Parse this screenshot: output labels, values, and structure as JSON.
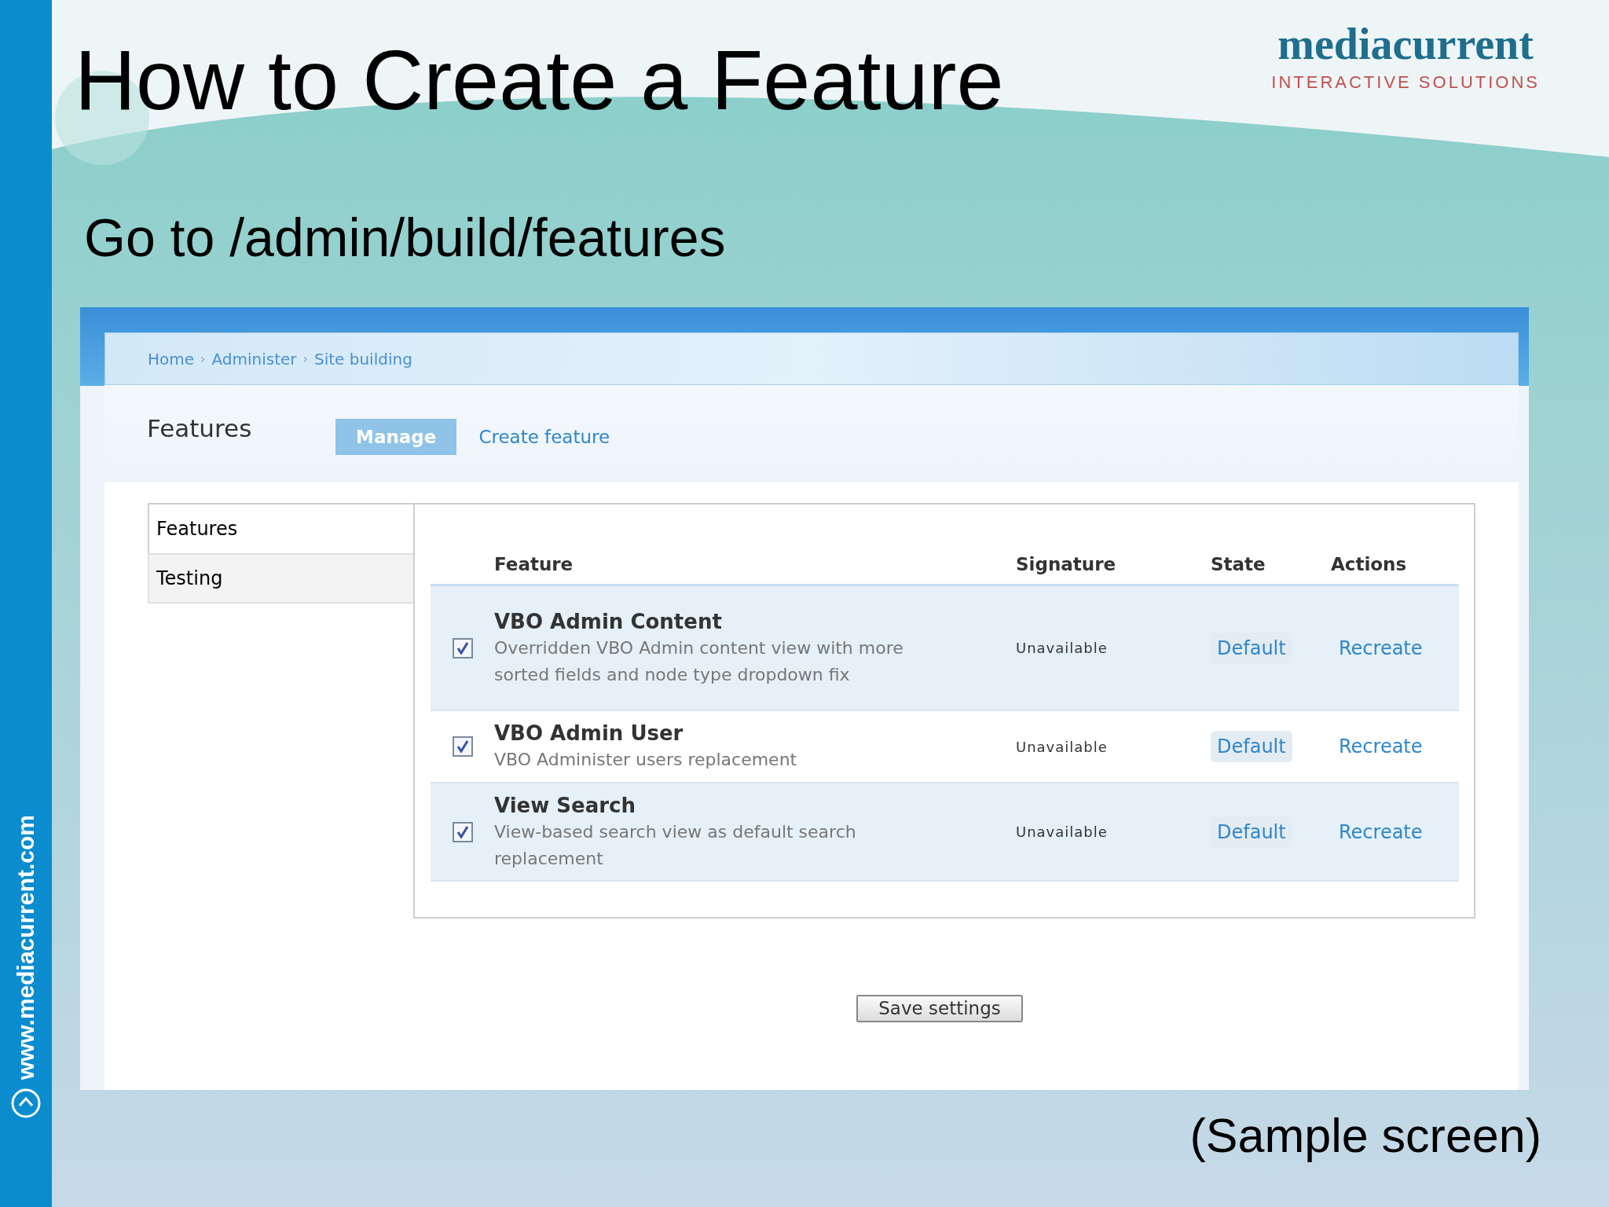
{
  "slide": {
    "title": "How to Create a Feature",
    "subtitle": "Go to /admin/build/features",
    "logo": {
      "name": "mediacurrent",
      "tagline": "INTERACTIVE SOLUTIONS"
    },
    "side_url": "www.mediacurrent.com",
    "caption": "(Sample screen)"
  },
  "screen": {
    "breadcrumb": [
      {
        "label": "Home",
        "separator": "›"
      },
      {
        "label": "Administer",
        "separator": "›"
      },
      {
        "label": "Site building"
      }
    ],
    "page_title": "Features",
    "tabs": [
      {
        "label": "Manage",
        "selected": true
      },
      {
        "label": "Create feature",
        "selected": false
      }
    ],
    "vertical_tabs": [
      {
        "label": "Features",
        "selected": true
      },
      {
        "label": "Testing",
        "selected": false
      }
    ],
    "table": {
      "columns": [
        "Feature",
        "Signature",
        "State",
        "Actions"
      ],
      "rows": [
        {
          "checked": true,
          "name": "VBO Admin Content",
          "description": "Overridden VBO Admin content view with more sorted fields and node type dropdown fix",
          "signature": "Unavailable",
          "state": "Default",
          "action": "Recreate"
        },
        {
          "checked": true,
          "name": "VBO Admin User",
          "description": "VBO Administer users replacement",
          "signature": "Unavailable",
          "state": "Default",
          "action": "Recreate"
        },
        {
          "checked": true,
          "name": "View Search",
          "description": "View-based search view as default search replacement",
          "signature": "Unavailable",
          "state": "Default",
          "action": "Recreate"
        }
      ]
    },
    "save_button": "Save settings"
  }
}
